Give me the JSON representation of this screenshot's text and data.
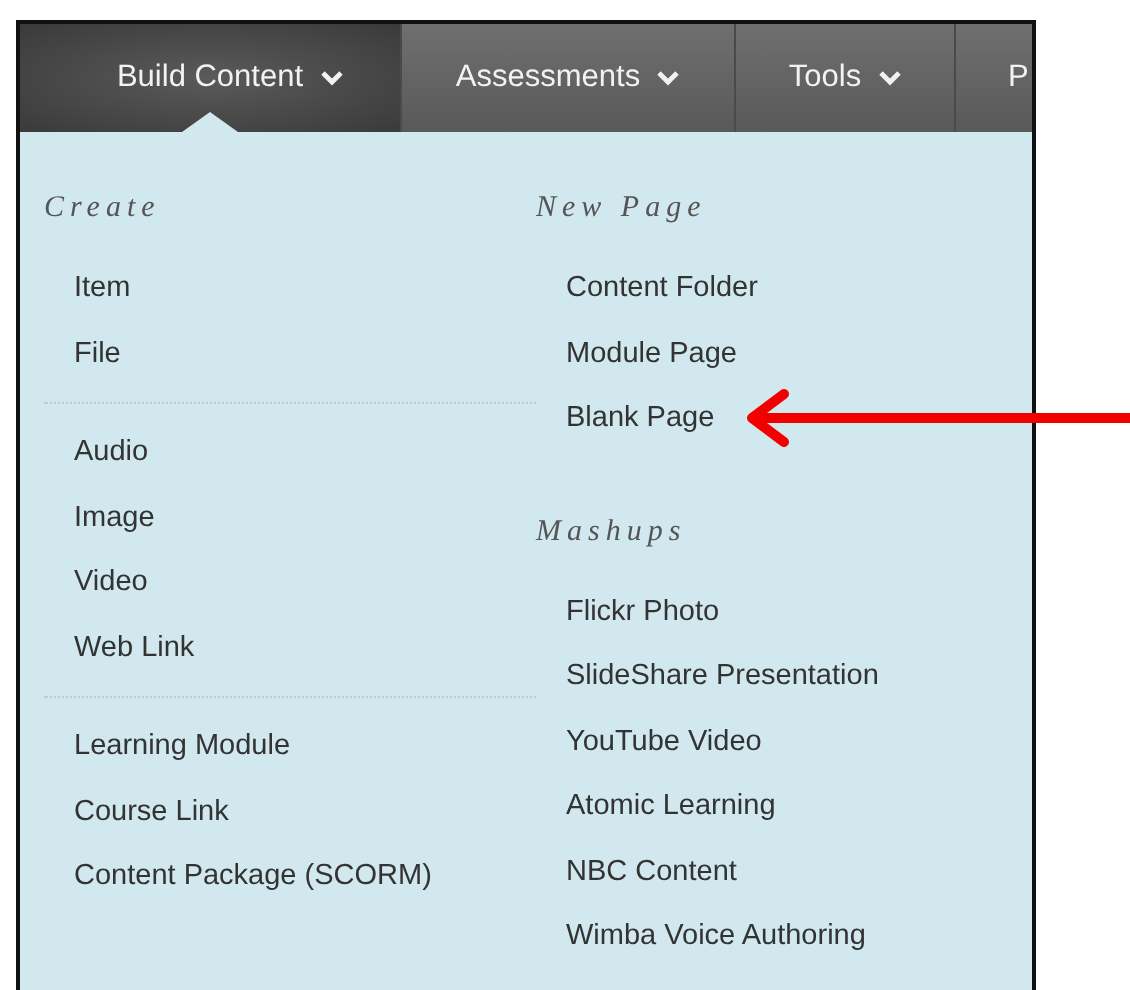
{
  "nav": {
    "tabs": [
      {
        "label": "Build Content",
        "selected": true,
        "chevron": true
      },
      {
        "label": "Assessments",
        "selected": false,
        "chevron": true
      },
      {
        "label": "Tools",
        "selected": false,
        "chevron": true
      },
      {
        "label": "P",
        "selected": false,
        "chevron": false
      }
    ]
  },
  "menu": {
    "columns": [
      {
        "groups": [
          {
            "heading": "Create",
            "items": [
              "Item",
              "File"
            ]
          },
          {
            "items": [
              "Audio",
              "Image",
              "Video",
              "Web Link"
            ]
          },
          {
            "items": [
              "Learning Module",
              "Course Link",
              "Content Package (SCORM)"
            ]
          }
        ]
      },
      {
        "groups": [
          {
            "heading": "New Page",
            "items": [
              "Content Folder",
              "Module Page",
              "Blank Page"
            ]
          },
          {
            "heading": "Mashups",
            "items": [
              "Flickr Photo",
              "SlideShare Presentation",
              "YouTube Video",
              "Atomic Learning",
              "NBC Content",
              "Wimba Voice Authoring"
            ]
          }
        ]
      }
    ]
  }
}
